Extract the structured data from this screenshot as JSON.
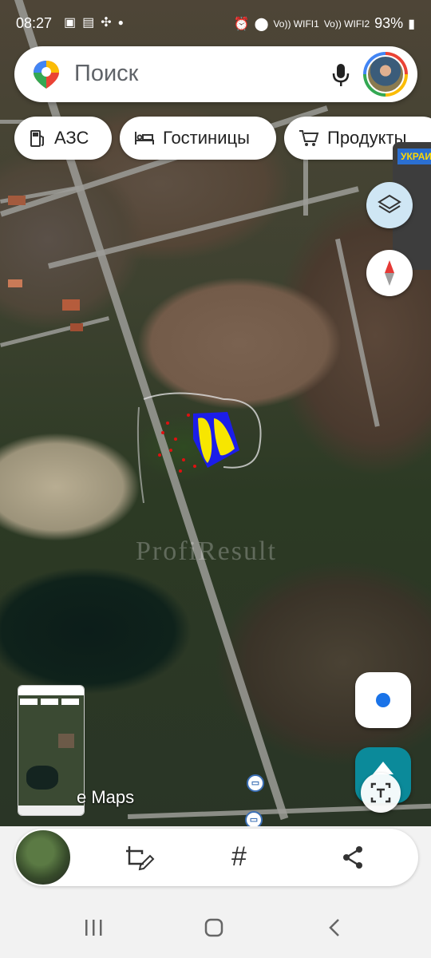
{
  "status_bar": {
    "time": "08:27",
    "left_icons": [
      "image-icon",
      "app-icon",
      "pinwheel-icon",
      "dot-icon"
    ],
    "wifi1_label": "Vo)) WIFI1",
    "wifi2_label": "Vo)) WIFI2",
    "battery": "93%"
  },
  "search": {
    "placeholder": "Поиск"
  },
  "chips": [
    {
      "label": "АЗС",
      "icon": "gas-station-icon"
    },
    {
      "label": "Гостиницы",
      "icon": "bed-icon"
    },
    {
      "label": "Продукты",
      "icon": "cart-icon"
    }
  ],
  "side_panel": {
    "label": "УКРАИ"
  },
  "watermark": "ProfiResult",
  "maps_label": "e Maps",
  "thumbnail": {
    "description": "map-screenshot-thumbnail"
  },
  "colors": {
    "selection_fill": "#f7e600",
    "selection_outline": "#1a1aff",
    "location_dot": "#1a73e8",
    "nav_button": "#0b8a9a"
  }
}
